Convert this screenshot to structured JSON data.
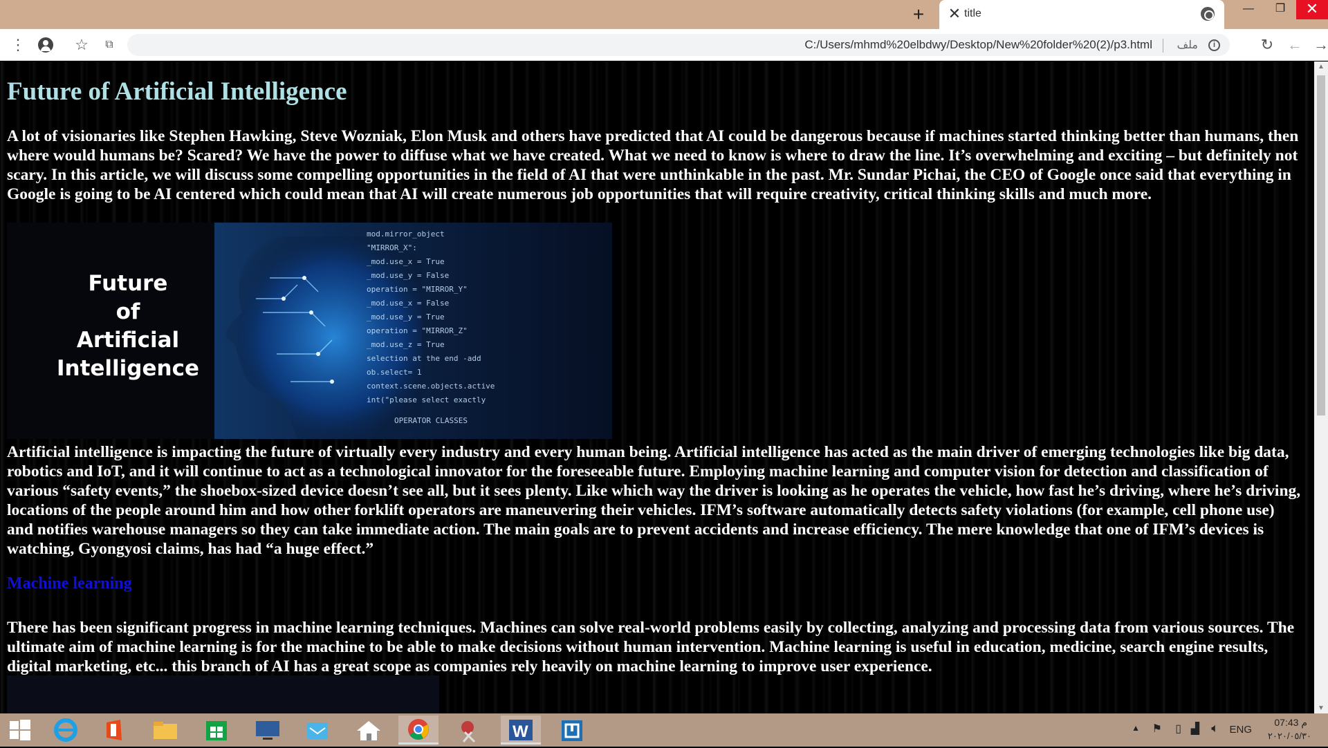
{
  "browser": {
    "tab_title": "title",
    "tab_close_glyph": "✕",
    "new_tab_glyph": "+",
    "url": "C:/Users/mhmd%20elbdwy/Desktop/New%20folder%20(2)/p3.html",
    "file_label": "ملف",
    "window_controls": {
      "minimize": "—",
      "maximize": "❐",
      "close": "✕"
    },
    "icons": [
      "menu-icon",
      "profile-icon",
      "star-icon",
      "translate-icon",
      "info-icon",
      "reload-icon",
      "back-icon",
      "forward-icon"
    ]
  },
  "article": {
    "title": "Future of Artificial Intelligence",
    "intro": "A lot of visionaries like Stephen Hawking, Steve Wozniak, Elon Musk and others have predicted that AI could be dangerous because if machines started thinking better than humans, then where would humans be? Scared? We have the power to diffuse what we have created. What we need to know is where to draw the line. It’s overwhelming and exciting – but definitely not scary. In this article, we will discuss some compelling opportunities in the field of AI that were unthinkable in the past. Mr. Sundar Pichai, the CEO of Google once said that everything in Google is going to be AI centered which could mean that AI will create numerous job opportunities that will require creativity, critical thinking skills and much more.",
    "hero_text": [
      "Future",
      "of",
      "Artificial",
      "Intelligence"
    ],
    "impact": "Artificial intelligence is impacting the future of virtually every industry and every human being. Artificial intelligence has acted as the main driver of emerging technologies like big data, robotics and IoT, and it will continue to act as a technological innovator for the foreseeable future. Employing machine learning and computer vision for detection and classification of various “safety events,” the shoebox-sized device doesn’t see all, but it sees plenty. Like which way the driver is looking as he operates the vehicle, how fast he’s driving, where he’s driving, locations of the people around him and how other forklift operators are maneuvering their vehicles. IFM’s software automatically detects safety violations (for example, cell phone use) and notifies warehouse managers so they can take immediate action. The main goals are to prevent accidents and increase efficiency. The mere knowledge that one of IFM’s devices is watching, Gyongyosi claims, has had “a huge effect.”",
    "ml_link": "Machine learning",
    "ml_text": "There has been significant progress in machine learning techniques. Machines can solve real-world problems easily by collecting, analyzing and processing data from various sources. The ultimate aim of machine learning is for the machine to be able to make decisions without human intervention. Machine learning is useful in education, medicine, search engine results, digital marketing, etc... this branch of AI has a great scope as companies rely heavily on machine learning to improve user experience."
  },
  "taskbar": {
    "apps": [
      "windows-start-icon",
      "internet-explorer-icon",
      "office-icon",
      "file-explorer-icon",
      "store-icon",
      "lenovo-icon",
      "mail-icon",
      "home-icon",
      "chrome-icon",
      "snipping-tool-icon",
      "word-icon",
      "app-icon"
    ],
    "language": "ENG",
    "time": "07:43 م",
    "date": "٢٠٢٠/٠٥/٣٠"
  },
  "colors": {
    "title_bar": "#cfab8f",
    "heading": "#aee0e6",
    "link": "#1010d0",
    "taskbar": "#b39a87"
  }
}
